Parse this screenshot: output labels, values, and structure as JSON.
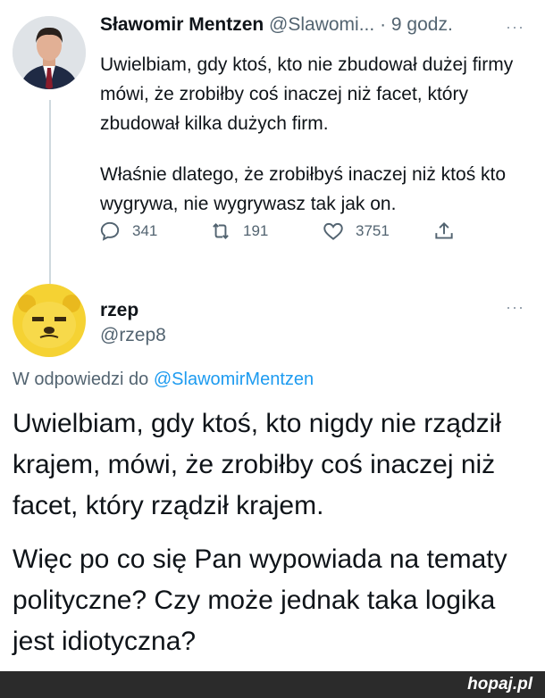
{
  "tweet1": {
    "author_name": "Sławomir Mentzen",
    "author_handle": "@Slawomi...",
    "separator": "·",
    "time": "9 godz.",
    "more": "···",
    "paragraph1": "Uwielbiam, gdy ktoś, kto nie zbudował dużej firmy mówi, że zrobiłby coś inaczej niż facet, który zbudował kilka dużych firm.",
    "paragraph2": "Właśnie dlatego, że zrobiłbyś inaczej niż ktoś kto wygrywa, nie wygrywasz tak jak on.",
    "replies": "341",
    "retweets": "191",
    "likes": "3751",
    "icons": [
      "reply-icon",
      "retweet-icon",
      "like-icon",
      "share-icon"
    ]
  },
  "tweet2": {
    "author_name": "rzep",
    "author_handle": "@rzep8",
    "more": "···",
    "reply_prefix": "W odpowiedzi do",
    "reply_mention": "@SlawomirMentzen",
    "paragraph1": "Uwielbiam, gdy ktoś, kto nigdy nie rządził krajem, mówi, że zrobiłby coś inaczej niż facet, który rządził krajem.",
    "paragraph2": "Więc po co się Pan wypowiada na tematy polityczne? Czy może jednak taka logika jest idiotyczna?"
  },
  "footer": {
    "brand": "hopaj.pl"
  },
  "colors": {
    "link": "#1d9bf0",
    "muted": "#536471",
    "text": "#0f1419",
    "avatar2_bg": "#f5d233"
  }
}
